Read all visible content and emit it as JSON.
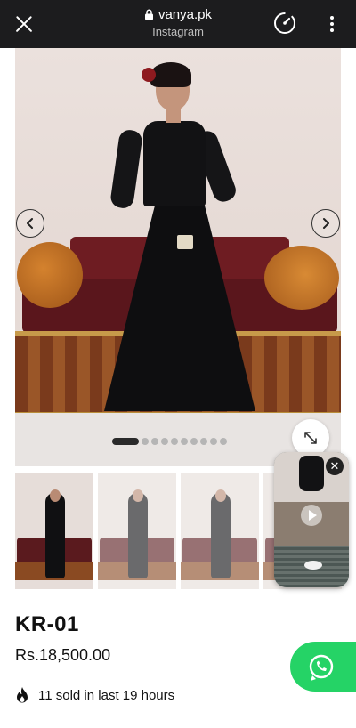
{
  "browser": {
    "domain": "vanya.pk",
    "source": "Instagram",
    "icons": {
      "close": "close-icon",
      "lock": "lock-icon",
      "speed": "speed-icon",
      "more": "more-vertical-icon"
    }
  },
  "gallery": {
    "icons": {
      "prev": "chevron-left-icon",
      "next": "chevron-right-icon",
      "zoom": "expand-icon"
    },
    "slide_count": 10,
    "active_slide": 1,
    "thumbnail_count": 4
  },
  "video": {
    "icons": {
      "play": "play-icon",
      "close": "close-icon"
    },
    "close_label": "✕"
  },
  "product": {
    "name": "KR-01",
    "price": "Rs.18,500.00",
    "sold_text": "11 sold in last 19 hours",
    "sold_icon": "flame-icon"
  },
  "whatsapp": {
    "icon": "whatsapp-icon",
    "color": "#25d366"
  },
  "colors": {
    "topbar": "#1c1c1e",
    "text": "#111111"
  }
}
